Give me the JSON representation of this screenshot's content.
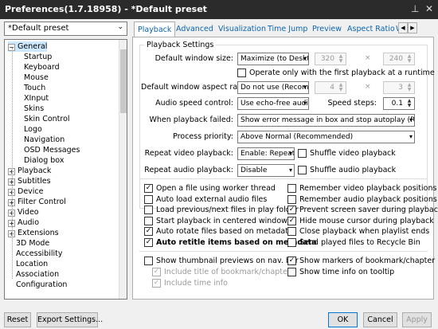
{
  "window": {
    "title": "Preferences(1.7.18958) - *Default preset"
  },
  "preset": {
    "value": "*Default preset"
  },
  "tree": {
    "items": [
      {
        "label": "General",
        "expander": "−",
        "selected": true
      },
      {
        "label": "Startup"
      },
      {
        "label": "Keyboard"
      },
      {
        "label": "Mouse"
      },
      {
        "label": "Touch"
      },
      {
        "label": "XInput"
      },
      {
        "label": "Skins"
      },
      {
        "label": "Skin Control"
      },
      {
        "label": "Logo"
      },
      {
        "label": "Navigation"
      },
      {
        "label": "OSD Messages"
      },
      {
        "label": "Dialog box"
      },
      {
        "label": "Playback",
        "expander": "+"
      },
      {
        "label": "Subtitles",
        "expander": "+"
      },
      {
        "label": "Device",
        "expander": "+"
      },
      {
        "label": "Filter Control",
        "expander": "+"
      },
      {
        "label": "Video",
        "expander": "+"
      },
      {
        "label": "Audio",
        "expander": "+"
      },
      {
        "label": "Extensions",
        "expander": "+"
      },
      {
        "label": "3D Mode"
      },
      {
        "label": "Accessibility"
      },
      {
        "label": "Location"
      },
      {
        "label": "Association"
      },
      {
        "label": "Configuration"
      }
    ]
  },
  "tabs": [
    "Playback",
    "Advanced",
    "Visualization",
    "Time Jump",
    "Preview",
    "Aspect Ratio",
    "Wi"
  ],
  "playback_settings": {
    "title": "Playback Settings",
    "default_window_size_label": "Default window size:",
    "default_window_size_value": "Maximize (to Deskt",
    "size_w": "320",
    "size_h": "240",
    "times": "×",
    "first_playback_only": "Operate only with the first playback at a runtime",
    "aspect_label": "Default window aspect ratio:",
    "aspect_value": "Do not use (Recom",
    "aspect_w": "4",
    "aspect_h": "3",
    "audio_speed_label": "Audio speed control:",
    "audio_speed_value": "Use echo-free audi",
    "speed_steps_label": "Speed steps:",
    "speed_steps_value": "0.1",
    "playback_failed_label": "When playback failed:",
    "playback_failed_value": "Show error message in box and stop autoplay (Recom",
    "process_priority_label": "Process priority:",
    "process_priority_value": "Above Normal (Recommended)",
    "repeat_video_label": "Repeat video playback:",
    "repeat_video_value": "Enable: Repeat",
    "shuffle_video": "Shuffle video playback",
    "repeat_audio_label": "Repeat audio playback:",
    "repeat_audio_value": "Disable",
    "shuffle_audio": "Shuffle audio playback"
  },
  "options": {
    "left": [
      {
        "label": "Open a file using worker thread",
        "checked": true
      },
      {
        "label": "Auto load external audio files",
        "checked": false
      },
      {
        "label": "Load previous/next files in play folder",
        "checked": false
      },
      {
        "label": "Start playback in centered window",
        "checked": false
      },
      {
        "label": "Auto rotate files based on metadata",
        "checked": true
      },
      {
        "label": "Auto retitle items based on metadata",
        "checked": true,
        "bold": true
      }
    ],
    "right": [
      {
        "label": "Remember video playback positions",
        "checked": false
      },
      {
        "label": "Remember audio playback positions",
        "checked": false
      },
      {
        "label": "Prevent screen saver during playback",
        "checked": true
      },
      {
        "label": "Hide mouse cursor during playback",
        "checked": true
      },
      {
        "label": "Close playback when playlist ends",
        "checked": false
      },
      {
        "label": "Send played files to Recycle Bin",
        "checked": false
      }
    ]
  },
  "thumbnails": {
    "show_thumbnail": {
      "label": "Show thumbnail previews on nav. bar",
      "checked": false
    },
    "include_title": {
      "label": "Include title of bookmark/chapter",
      "checked": true
    },
    "include_time": {
      "label": "Include time info",
      "checked": true
    },
    "show_markers": {
      "label": "Show markers of bookmark/chapter",
      "checked": true
    },
    "show_time_tooltip": {
      "label": "Show time info on tooltip",
      "checked": false
    }
  },
  "buttons": {
    "reset": "Reset",
    "export": "Export Settings...",
    "ok": "OK",
    "cancel": "Cancel",
    "apply": "Apply"
  },
  "icons": {
    "check": "✓",
    "dropdown": "▾",
    "close": "✕",
    "pin": "📌"
  }
}
